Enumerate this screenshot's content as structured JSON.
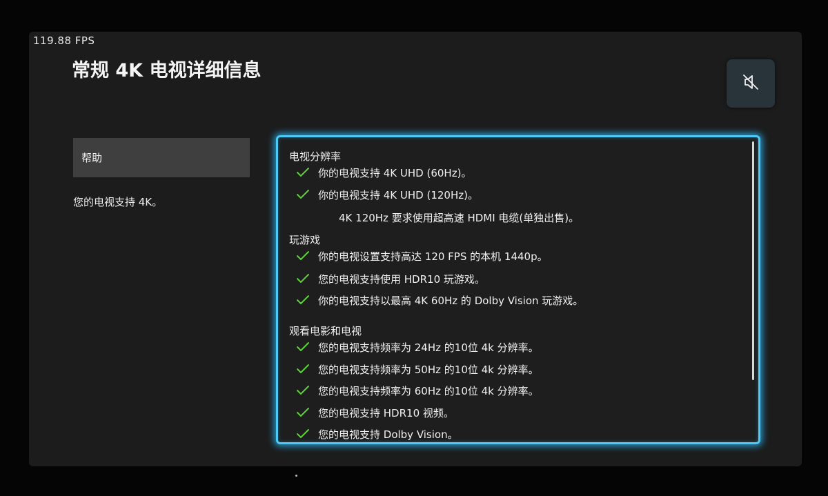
{
  "fps_counter": "119.88  FPS",
  "page_title": "常规  4K 电视详细信息",
  "mute_button": {
    "icon": "speaker-muted-icon"
  },
  "sidebar": {
    "help_label": "帮助",
    "summary": "您的电视支持 4K。"
  },
  "details": {
    "sections": [
      {
        "title": "电视分辨率",
        "items": [
          {
            "text": "你的电视支持 4K UHD (60Hz)。",
            "status": "check"
          },
          {
            "text": "你的电视支持 4K UHD (120Hz)。",
            "status": "check"
          },
          {
            "text": "4K 120Hz 要求使用超高速 HDMI 电缆(单独出售)。",
            "status": "none"
          }
        ]
      },
      {
        "title": "玩游戏",
        "items": [
          {
            "text": "你的电视设置支持高达 120 FPS 的本机 1440p。",
            "status": "check"
          },
          {
            "text": "您的电视支持使用 HDR10 玩游戏。",
            "status": "check"
          },
          {
            "text": "你的电视支持以最高 4K 60Hz 的 Dolby Vision 玩游戏。",
            "status": "check"
          }
        ]
      },
      {
        "title": "观看电影和电视",
        "items": [
          {
            "text": "您的电视支持频率为 24Hz 的10位 4k 分辨率。",
            "status": "check"
          },
          {
            "text": "您的电视支持频率为 50Hz 的10位 4k 分辨率。",
            "status": "check"
          },
          {
            "text": "您的电视支持频率为 60Hz 的10位 4k 分辨率。",
            "status": "check"
          },
          {
            "text": "您的电视支持 HDR10 视频。",
            "status": "check"
          },
          {
            "text": "您的电视支持 Dolby Vision。",
            "status": "check"
          }
        ]
      }
    ]
  },
  "colors": {
    "check": "#5fd13a",
    "focus_border": "#4ec9f5",
    "background": "#1c1c1c"
  }
}
